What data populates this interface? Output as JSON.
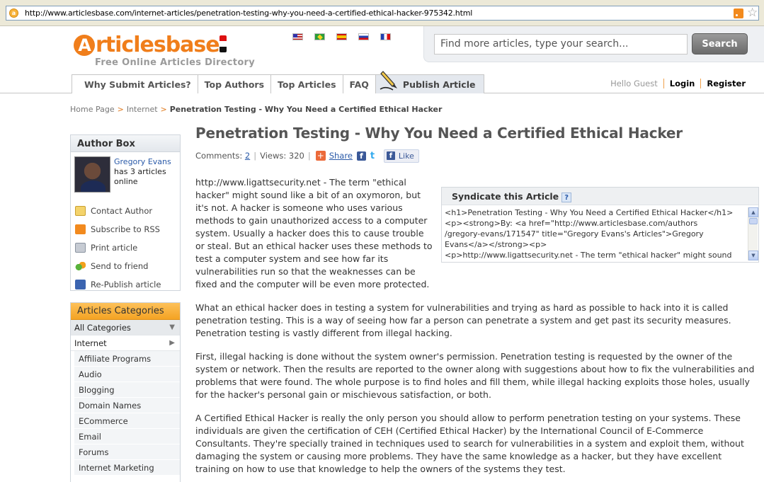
{
  "browser": {
    "url": "http://www.articlesbase.com/internet-articles/penetration-testing-why-you-need-a-certified-ethical-hacker-975342.html"
  },
  "header": {
    "logo_rest": "rticlesbase",
    "logo_a": "A",
    "tagline": "Free Online Articles Directory",
    "search_placeholder": "Find more articles, type your search...",
    "search_button": "Search"
  },
  "nav": {
    "tabs": [
      "Why Submit Articles?",
      "Top Authors",
      "Top Articles",
      "FAQ",
      "Publish Article"
    ],
    "greeting": "Hello Guest",
    "login": "Login",
    "register": "Register"
  },
  "breadcrumb": {
    "items": [
      "Home Page",
      "Internet"
    ],
    "separator": ">",
    "current": "Penetration Testing - Why You Need a Certified Ethical Hacker"
  },
  "author_box": {
    "heading": "Author Box",
    "name": "Gregory Evans",
    "info": "has 3 articles online",
    "actions": [
      "Contact Author",
      "Subscribe to RSS",
      "Print article",
      "Send to friend",
      "Re-Publish article"
    ]
  },
  "categories": {
    "heading": "Articles Categories",
    "all": "All Categories",
    "selected": "Internet",
    "subs": [
      "Affiliate Programs",
      "Audio",
      "Blogging",
      "Domain Names",
      "ECommerce",
      "Email",
      "Forums",
      "Internet Marketing"
    ]
  },
  "article": {
    "title": "Penetration Testing - Why You Need a Certified Ethical Hacker",
    "comments_label": "Comments:",
    "comments_count": "2",
    "views_label": "Views: 320",
    "share_label": "Share",
    "like_label": "Like",
    "paragraphs": [
      "http://www.ligattsecurity.net - The term \"ethical hacker\" might sound like a bit of an oxymoron, but it's not. A hacker is someone who uses various methods to gain unauthorized access to a computer system.  Usually a hacker does this to cause trouble or steal. But an ethical hacker uses these methods to test a computer system and see how far its vulnerabilities run so that the weaknesses can be fixed and the computer will be even more protected.",
      "What an ethical hacker does in testing a system for vulnerabilities and trying as hard as possible to hack into it is called penetration testing. This is a way of seeing how far a person can penetrate a system and get past its security measures. Penetration testing is vastly different from illegal hacking.",
      "First, illegal hacking is done without the system owner's permission. Penetration testing is requested by the owner of the system or network. Then the results are reported to the owner along with suggestions about how to fix the vulnerabilities and problems that were found. The whole purpose is to find holes and fill them, while illegal hacking exploits those holes, usually for the hacker's personal gain or mischievous satisfaction, or both.",
      "A Certified Ethical Hacker is really the only person you should allow to perform penetration testing on your systems. These individuals are given the certification of CEH (Certified Ethical Hacker) by the International Council of E-Commerce Consultants. They're specially trained in techniques used to search for vulnerabilities in a system and exploit them, without damaging the system or causing more problems.  They have the same knowledge as a hacker, but they have excellent training on how to use that knowledge to help the owners of the systems they test."
    ]
  },
  "syndicate": {
    "heading": "Syndicate this Article",
    "help": "?",
    "code_lines": [
      "<h1>Penetration Testing - Why You Need a Certified Ethical Hacker</h1>",
      "<p><strong>By: <a href=\"http://www.articlesbase.com/authors",
      "/gregory-evans/171547\" title=\"Gregory Evans's Articles\">Gregory",
      "Evans</a></strong><p>",
      "<p>http://www.ligattsecurity.net - The term \"ethical hacker\" might sound"
    ]
  }
}
